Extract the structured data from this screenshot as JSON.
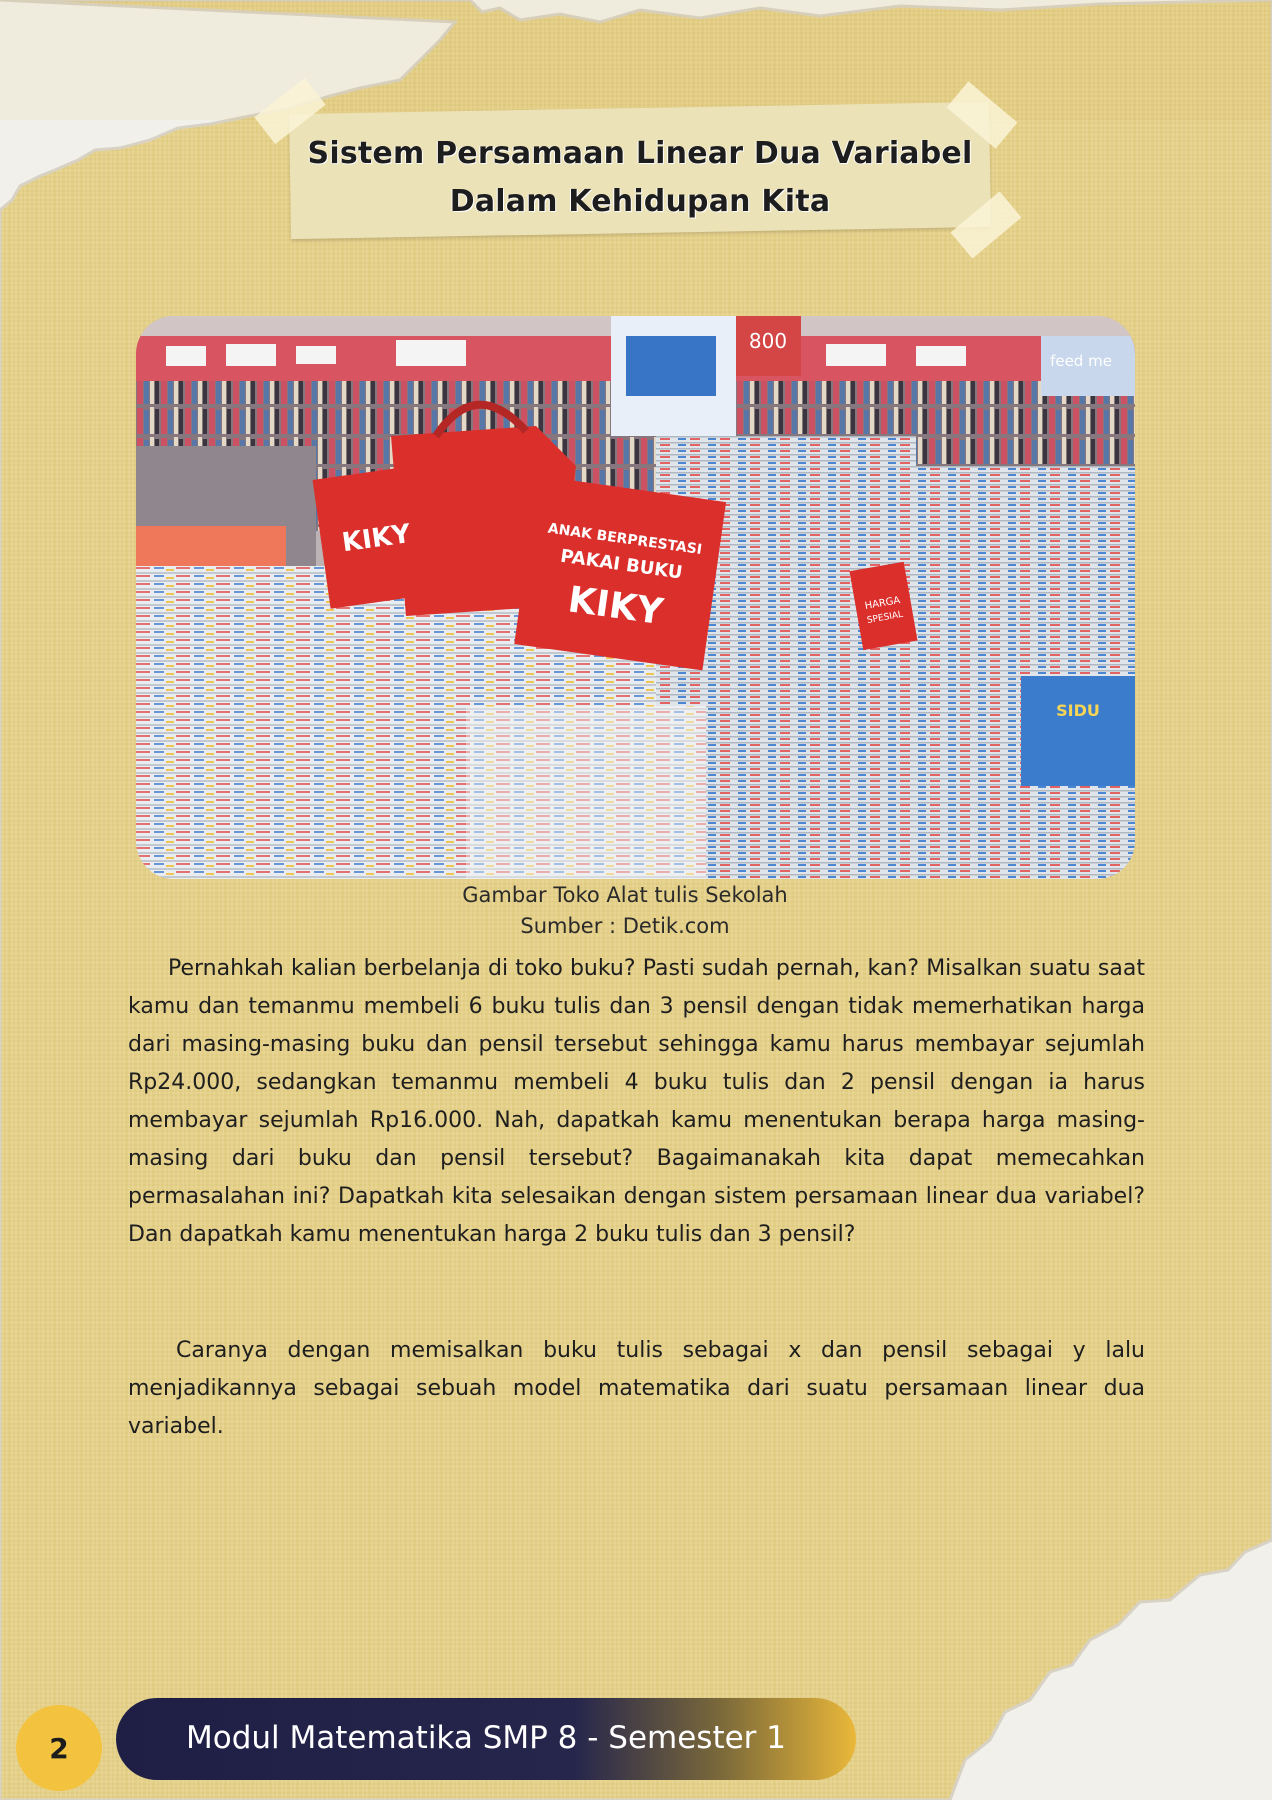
{
  "title": {
    "line1": "Sistem Persamaan Linear Dua Variabel",
    "line2": "Dalam Kehidupan Kita"
  },
  "figure": {
    "image_icon": "bookstore-photo",
    "photo_texts": [
      "ANAK BERPRESTASI",
      "PAKAI BUKU",
      "KIKY",
      "HARGA SPESIAL",
      "800",
      "feed me",
      "SIDU"
    ],
    "caption": "Gambar Toko Alat tulis Sekolah",
    "source": "Sumber  : Detik.com"
  },
  "body": {
    "paragraph1": "Pernahkah kalian berbelanja di toko buku? Pasti sudah pernah, kan? Misalkan suatu saat kamu dan temanmu membeli 6 buku tulis dan 3 pensil dengan tidak memerhatikan harga dari masing-masing buku dan pensil tersebut sehingga kamu harus membayar sejumlah Rp24.000, sedangkan temanmu membeli 4 buku tulis dan 2 pensil dengan ia harus membayar sejumlah Rp16.000. Nah, dapatkah kamu menentukan berapa harga masing-masing dari buku dan pensil tersebut? Bagaimanakah kita dapat memecahkan permasalahan ini? Dapatkah kita selesaikan dengan sistem persamaan linear dua variabel? Dan dapatkah kamu menentukan harga 2 buku tulis dan 3 pensil?",
    "paragraph2": "Caranya dengan memisalkan buku tulis sebagai x dan pensil sebagai y lalu menjadikannya sebagai sebuah model matematika dari suatu persamaan linear dua variabel."
  },
  "footer": {
    "page_number": "2",
    "module_title": "Modul Matematika SMP 8 - Semester 1"
  },
  "colors": {
    "paper": "#e6d189",
    "banner": "#ebe2b8",
    "footer_dark": "#1f1f46",
    "footer_gold": "#f3c33f",
    "kiky_red": "#d9231f"
  }
}
